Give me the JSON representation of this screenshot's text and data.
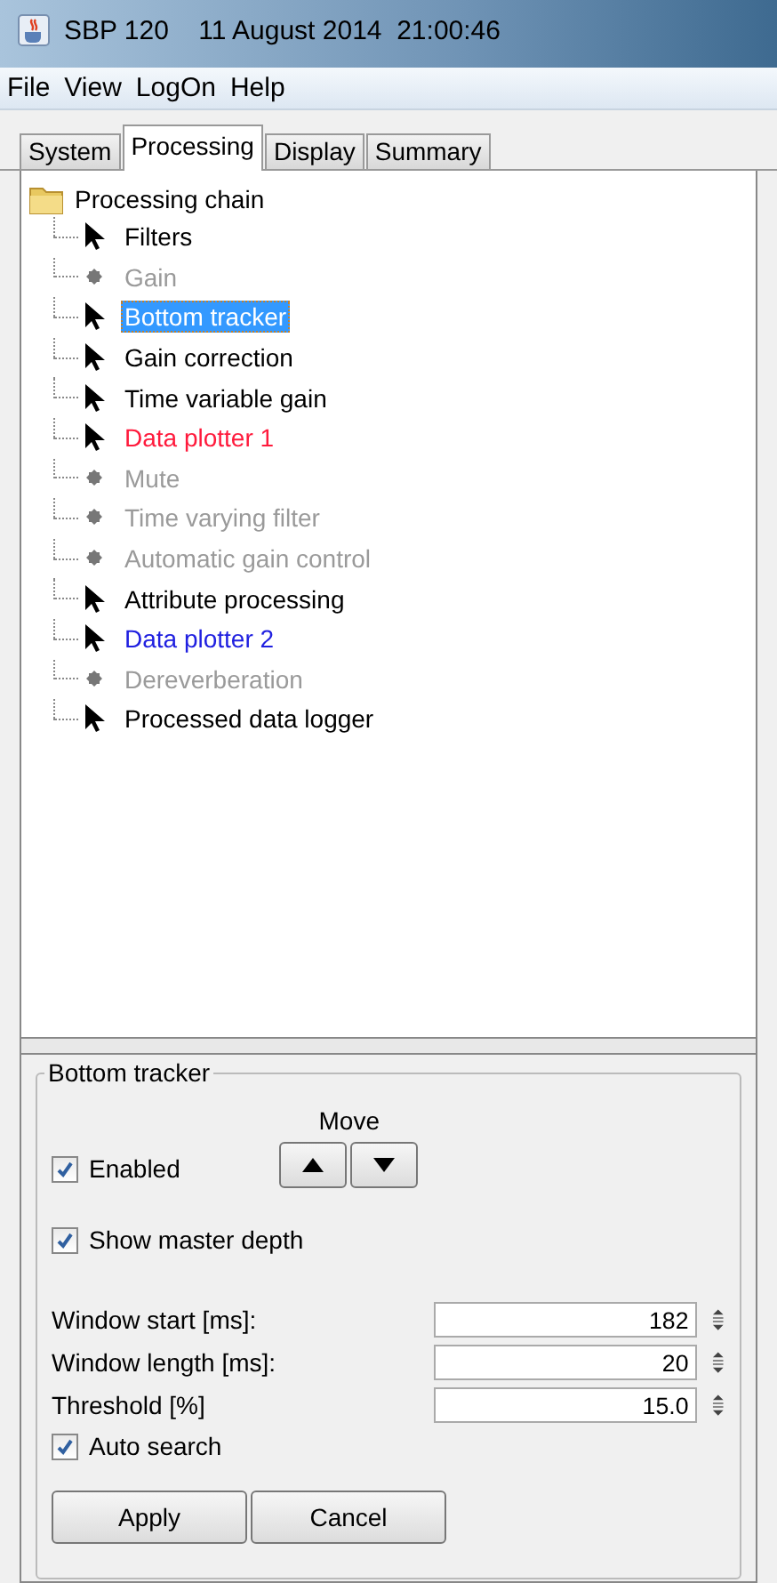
{
  "window": {
    "title": "SBP 120    11 August 2014  21:00:46"
  },
  "menu": [
    "File",
    "View",
    "LogOn",
    "Help"
  ],
  "tabs": [
    {
      "label": "System",
      "selected": false
    },
    {
      "label": "Processing",
      "selected": true
    },
    {
      "label": "Display",
      "selected": false
    },
    {
      "label": "Summary",
      "selected": false
    }
  ],
  "tree": {
    "label": "Processing chain",
    "children": [
      {
        "label": "Filters",
        "enabled": true,
        "selected": false
      },
      {
        "label": "Gain",
        "enabled": false,
        "selected": false
      },
      {
        "label": "Bottom tracker",
        "enabled": true,
        "selected": true
      },
      {
        "label": "Gain correction",
        "enabled": true,
        "selected": false
      },
      {
        "label": "Time variable gain",
        "enabled": true,
        "selected": false
      },
      {
        "label": "Data plotter 1",
        "enabled": true,
        "selected": false,
        "color": "#ff1a3c"
      },
      {
        "label": "Mute",
        "enabled": false,
        "selected": false
      },
      {
        "label": "Time varying filter",
        "enabled": false,
        "selected": false
      },
      {
        "label": "Automatic gain control",
        "enabled": false,
        "selected": false
      },
      {
        "label": "Attribute processing",
        "enabled": true,
        "selected": false
      },
      {
        "label": "Data plotter 2",
        "enabled": true,
        "selected": false,
        "color": "#2020e0"
      },
      {
        "label": "Dereverberation",
        "enabled": false,
        "selected": false
      },
      {
        "label": "Processed data logger",
        "enabled": true,
        "selected": false
      }
    ]
  },
  "panel": {
    "title": "Bottom tracker",
    "move_label": "Move",
    "enabled": {
      "label": "Enabled",
      "checked": true
    },
    "show_master_depth": {
      "label": "Show master depth",
      "checked": true
    },
    "fields": [
      {
        "label": "Window start [ms]:",
        "value": "182"
      },
      {
        "label": "Window length [ms]:",
        "value": "20"
      },
      {
        "label": "Threshold [%]",
        "value": "15.0"
      }
    ],
    "auto_search": {
      "label": "Auto search",
      "checked": true
    },
    "buttons": [
      "Apply",
      "Cancel"
    ]
  }
}
